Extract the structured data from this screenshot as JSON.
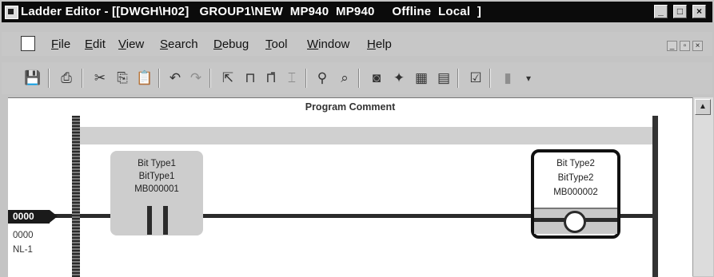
{
  "titlebar": {
    "title": "Ladder Editor - [[DWGH\\H02]   GROUP1\\NEW  MP940  MP940     Offline  Local  ]",
    "min": "_",
    "max": "□",
    "close": "×"
  },
  "menubar": {
    "items": [
      "File",
      "Edit",
      "View",
      "Search",
      "Debug",
      "Tool",
      "Window",
      "Help"
    ],
    "mdi_min": "_",
    "mdi_restore": "▫",
    "mdi_close": "×"
  },
  "toolbar": {
    "icons": {
      "save": "💾",
      "print": "⎙",
      "cut": "✂",
      "copy": "⎘",
      "paste": "📋",
      "undo": "↶",
      "redo": "↷",
      "select": "⇱",
      "contact": "⊓",
      "coil": "⊓̄",
      "line": "⌶",
      "find": "⚲",
      "find2": "⌕",
      "insert1": "◙",
      "insert2": "✦",
      "insert3": "▦",
      "insert4": "▤",
      "check": "☑",
      "page": "▮",
      "more": "▾"
    }
  },
  "editor": {
    "program_comment": "Program Comment",
    "rung": {
      "number": "0000",
      "step": "0000",
      "label": "NL-1"
    },
    "contact": {
      "type_label": "Bit Type1",
      "name": "BitType1",
      "address": "MB000001"
    },
    "coil": {
      "type_label": "Bit Type2",
      "name": "BitType2",
      "address": "MB000002"
    }
  }
}
